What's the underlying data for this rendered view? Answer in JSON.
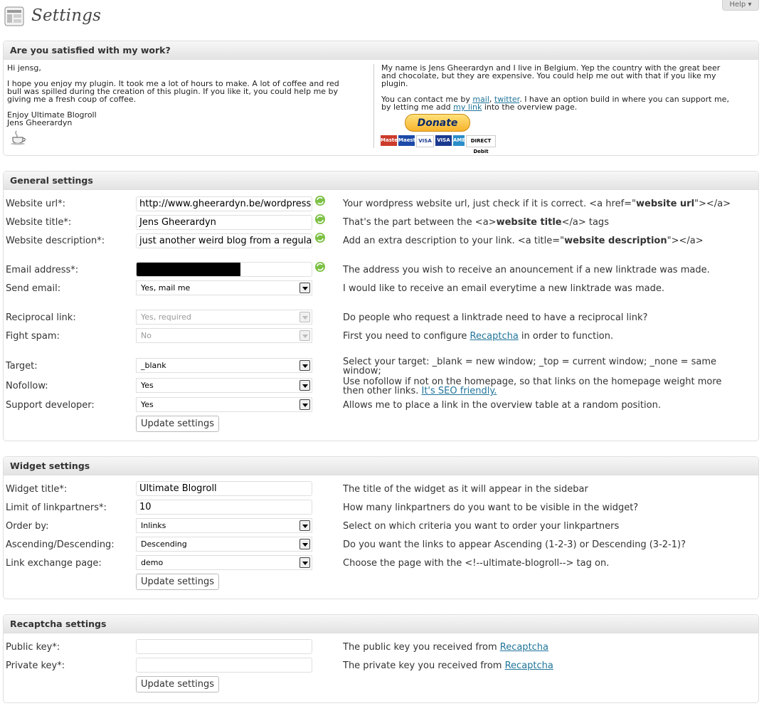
{
  "page": {
    "title": "Settings",
    "help_label": "Help"
  },
  "intro_box": {
    "heading": "Are you satisfied with my work?",
    "left": {
      "greeting": "Hi jensg,",
      "p1_l1": "I hope you enjoy my plugin. It took me a lot of hours to make. A lot of coffee and red",
      "p1_l2": "bull was spilled during the creation of this plugin. If you like it, you could help me by",
      "p1_l3": "giving me a fresh coup of coffee.",
      "sign_l1": "Enjoy Ultimate Blogroll",
      "sign_l2": "Jens Gheerardyn",
      "coffee_icon": "coffee-cup-icon"
    },
    "right": {
      "p1_l1": "My name is Jens Gheerardyn and I live in Belgium. Yep the country with the great beer",
      "p1_l2": "and chocolate, but they are expensive. You could help me out with that if you like my",
      "p1_l3": "plugin.",
      "p2_a": "You can contact me by ",
      "mail_link": "mail",
      "comma": ", ",
      "twitter_link": "twitter",
      "p2_b": ". I have an option build in where you can support me,",
      "p3_a": "by letting me add ",
      "mylink_link": "my link",
      "p3_b": " into the overview page.",
      "donate_label": "Donate",
      "cards": [
        "MasterCard",
        "Maestro",
        "VISA",
        "VISA",
        "AMEX",
        "DIRECT Debit"
      ]
    }
  },
  "general": {
    "heading": "General settings",
    "website_url": {
      "label": "Website url*:",
      "value": "http://www.gheerardyn.be/wordpress",
      "desc_a": "Your wordpress website url, just check if it is correct. <a href=\"",
      "desc_b": "website url",
      "desc_c": "\"></a>"
    },
    "website_title": {
      "label": "Website title*:",
      "value": "Jens Gheerardyn",
      "desc_a": "That's the part between the <a>",
      "desc_b": "website title",
      "desc_c": "</a> tags"
    },
    "website_description": {
      "label": "Website description*:",
      "value": "just another weird blog from a regular",
      "desc_a": "Add an extra description to your link. <a title=\"",
      "desc_b": "website description",
      "desc_c": "\"></a>"
    },
    "email": {
      "label": "Email address*:",
      "desc": "The address you wish to receive an anouncement if a new linktrade was made."
    },
    "send_email": {
      "label": "Send email:",
      "value": "Yes, mail me",
      "desc": "I would like to receive an email everytime a new linktrade was made."
    },
    "reciprocal": {
      "label": "Reciprocal link:",
      "value": "Yes, required",
      "desc": "Do people who request a linktrade need to have a reciprocal link?"
    },
    "fight_spam": {
      "label": "Fight spam:",
      "value": "No",
      "desc_a": "First you need to configure ",
      "desc_link": "Recaptcha",
      "desc_b": " in order to function."
    },
    "target": {
      "label": "Target:",
      "value": "_blank",
      "desc_l1": "Select your target: _blank = new window; _top = current window; _none = same",
      "desc_l2": "window;"
    },
    "nofollow": {
      "label": "Nofollow:",
      "value": "Yes",
      "desc_l1": "Use nofollow if not on the homepage, so that links on the homepage weight more",
      "desc_l2a": "then other links. ",
      "desc_link": "It's SEO friendly."
    },
    "support": {
      "label": "Support developer:",
      "value": "Yes",
      "desc": "Allows me to place a link in the overview table at a random position."
    },
    "button": "Update settings"
  },
  "widget": {
    "heading": "Widget settings",
    "title": {
      "label": "Widget title*:",
      "value": "Ultimate Blogroll",
      "desc": "The title of the widget as it will appear in the sidebar"
    },
    "limit": {
      "label": "Limit of linkpartners*:",
      "value": "10",
      "desc": "How many linkpartners do you want to be visible in the widget?"
    },
    "order_by": {
      "label": "Order by:",
      "value": "Inlinks",
      "desc": "Select on which criteria you want to order your linkpartners"
    },
    "asc_desc": {
      "label": "Ascending/Descending:",
      "value": "Descending",
      "desc": "Do you want the links to appear Ascending (1-2-3) or Descending (3-2-1)?"
    },
    "exchange_page": {
      "label": "Link exchange page:",
      "value": "demo",
      "desc": "Choose the page with the <!--ultimate-blogroll--> tag on."
    },
    "button": "Update settings"
  },
  "recaptcha": {
    "heading": "Recaptcha settings",
    "public_key": {
      "label": "Public key*:",
      "desc_a": "The public key you received from ",
      "desc_link": "Recaptcha"
    },
    "private_key": {
      "label": "Private key*:",
      "desc_a": "The private key you received from ",
      "desc_link": "Recaptcha"
    },
    "button": "Update settings"
  }
}
